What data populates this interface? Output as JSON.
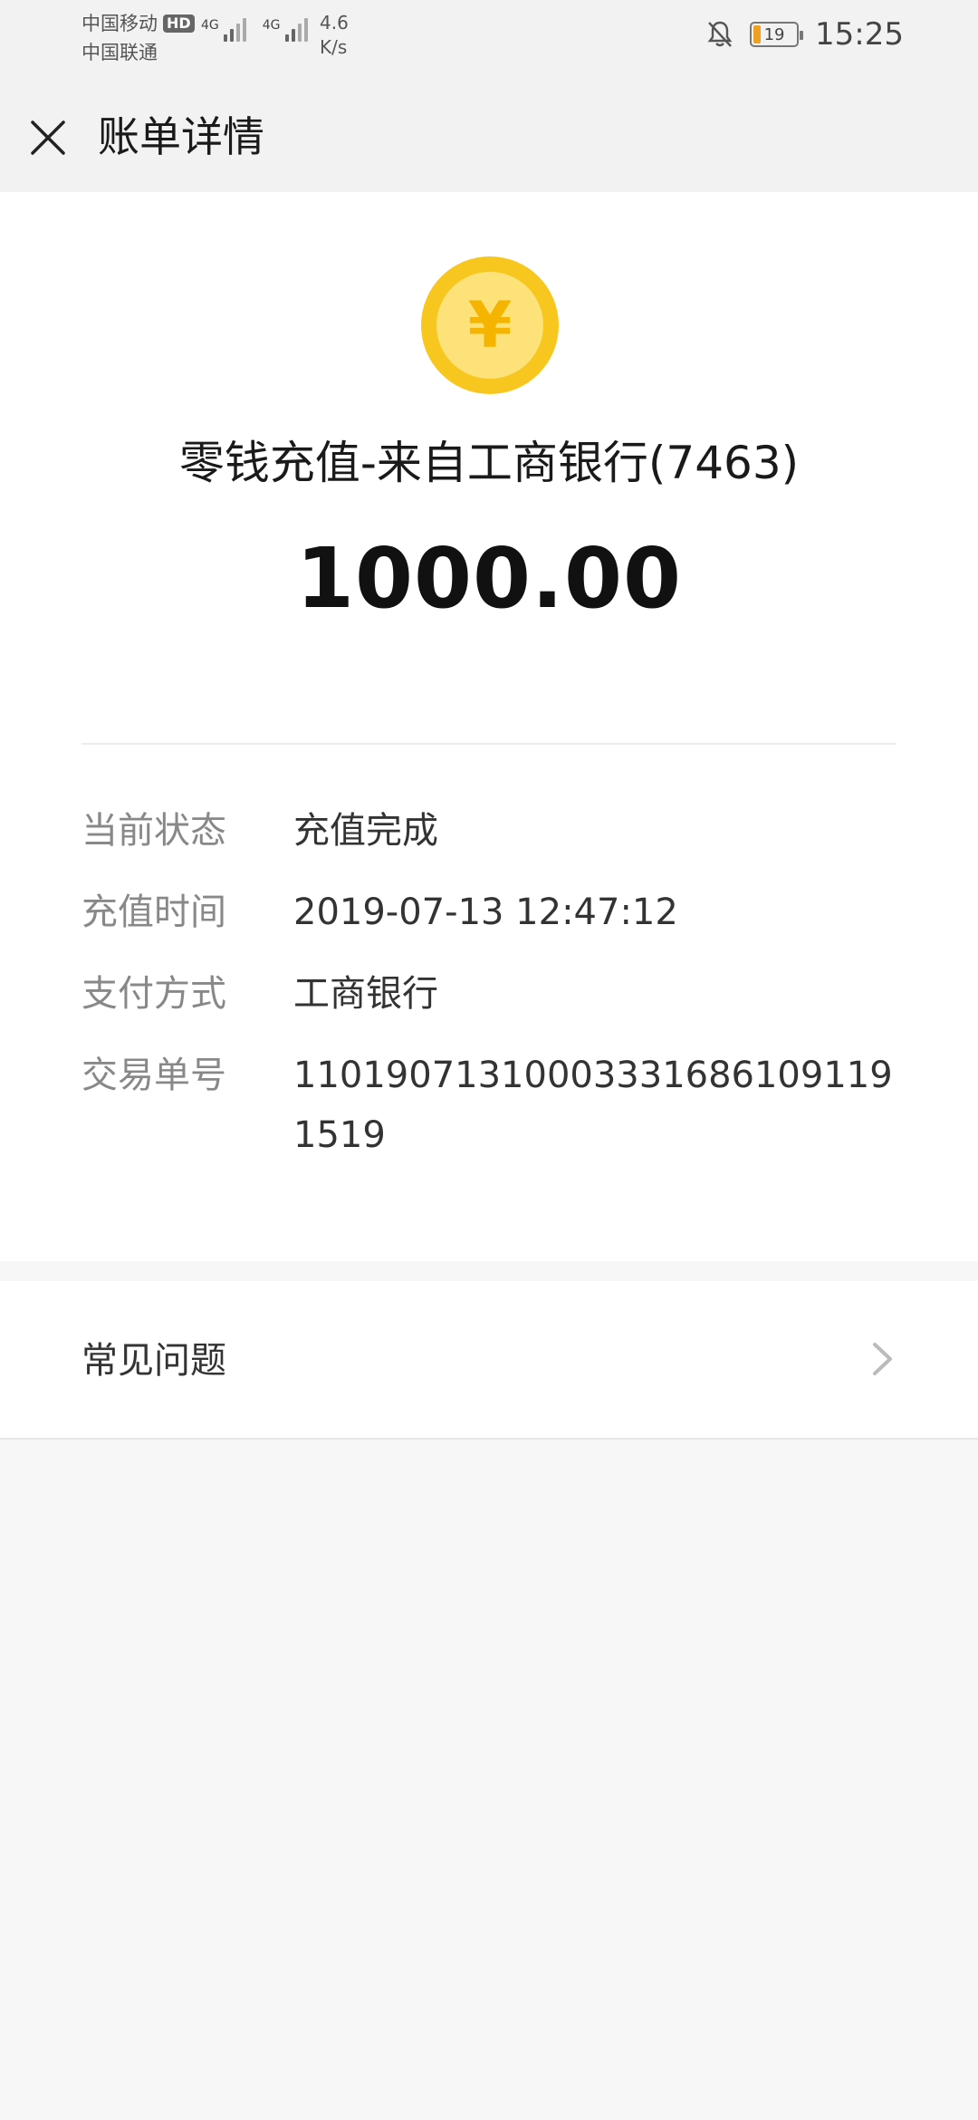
{
  "status_bar": {
    "carrier_1": "中国移动",
    "hd_badge": "HD",
    "carrier_2": "中国联通",
    "network_1": "4G",
    "network_2": "4G",
    "speed_value": "4.6",
    "speed_unit": "K/s",
    "battery": "19",
    "time": "15:25",
    "icons": [
      "signal-icon",
      "bell-off-icon",
      "battery-icon"
    ]
  },
  "header": {
    "title": "账单详情",
    "close_icon": "close-icon"
  },
  "transaction": {
    "icon": "yuan-coin-icon",
    "coin_symbol": "¥",
    "title": "零钱充值-来自工商银行(7463)",
    "amount": "1000.00"
  },
  "details": [
    {
      "label": "当前状态",
      "value": "充值完成"
    },
    {
      "label": "充值时间",
      "value": "2019-07-13 12:47:12"
    },
    {
      "label": "支付方式",
      "value": "工商银行"
    },
    {
      "label": "交易单号",
      "value": "110190713100033316861091191519"
    }
  ],
  "faq": {
    "label": "常见问题",
    "icon": "chevron-right-icon"
  },
  "colors": {
    "coin_outer": "#f7c71f",
    "coin_inner": "#fde179",
    "background": "#f7f7f7",
    "header_bg": "#f2f2f2"
  }
}
